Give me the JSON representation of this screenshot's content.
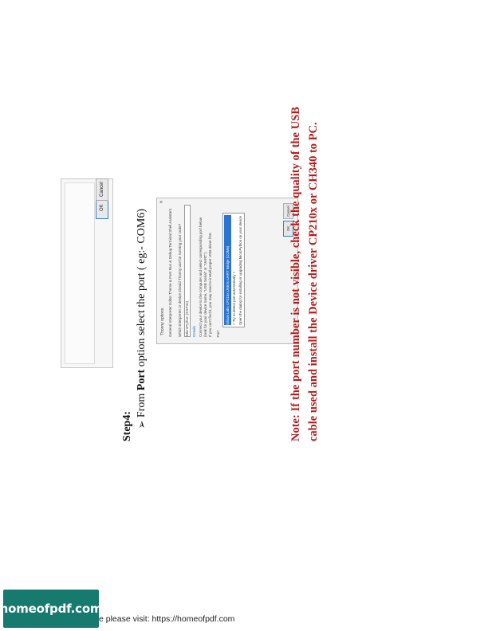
{
  "top_dialog": {
    "ok_label": "OK",
    "cancel_label": "Cancel"
  },
  "step": {
    "label": "Step4:",
    "bullet": "➢",
    "text_before": "From ",
    "text_bold": "Port",
    "text_after": " option select the port ( eg:- COM6)"
  },
  "dialog": {
    "title": "Thonny options",
    "tabs": "General   Interpreter   Editor   Theme & Font   Run & Debug   Terminal   Shell   Assistant",
    "question": "Which interpreter or device should Thonny use for running your code?",
    "interpreter_value": "MicroPython (ESP32)",
    "details_heading": "Details",
    "details_line1": "Connect your device to the computer and select corresponding port below",
    "details_line2": "(look for your device name, \"USB Serial\" or \"UART\").",
    "details_line3": "If you can't find it, you may need to install proper USB driver first.",
    "port_label": "Port",
    "port_options": [
      "Silicon Labs CP210x USB to UART Bridge (COM6)",
      "< Try to detect port automatically >",
      "Open the dialog for installing or upgrading MicroPython on your device"
    ],
    "ok_label": "OK",
    "cancel_label": "Cancel",
    "close_glyph": "×"
  },
  "note": "Note: If the port number is not visible, check the quality of the USB cable used and install the Device driver CP210x or CH340 to PC.",
  "footer": {
    "badge": "homeofpdf.com",
    "text": "e please visit: https://homeofpdf.com"
  },
  "colors": {
    "note": "#b71c1c",
    "badge": "#167a6e",
    "selection": "#2a74d4"
  }
}
